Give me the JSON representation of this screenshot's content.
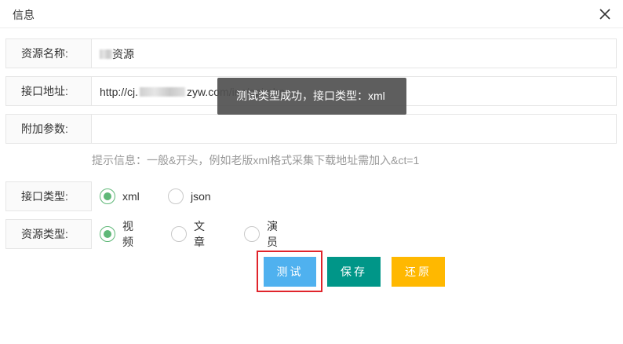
{
  "dialog": {
    "title": "信息",
    "close_icon": "close-icon"
  },
  "form": {
    "name": {
      "label": "资源名称:",
      "value_visible": "资源"
    },
    "api_url": {
      "label": "接口地址:",
      "value_prefix": "http://cj.",
      "value_suffix": "zyw.com/inc/api.php"
    },
    "params": {
      "label": "附加参数:",
      "value": ""
    },
    "hint": "提示信息：一般&开头，例如老版xml格式采集下载地址需加入&ct=1",
    "api_type": {
      "label": "接口类型:",
      "options": [
        {
          "label": "xml",
          "checked": true
        },
        {
          "label": "json",
          "checked": false
        }
      ]
    },
    "resource_type": {
      "label": "资源类型:",
      "options": [
        {
          "label": "视频",
          "checked": true
        },
        {
          "label": "文章",
          "checked": false
        },
        {
          "label": "演员",
          "checked": false
        }
      ]
    }
  },
  "buttons": {
    "test": "测试",
    "save": "保存",
    "reset": "还原"
  },
  "toast": "测试类型成功，接口类型：xml",
  "colors": {
    "accent_green": "#5fb878",
    "test_blue": "#4fb1ef",
    "save_teal": "#009688",
    "reset_yellow": "#ffb800",
    "highlight_red": "#e0242b"
  }
}
